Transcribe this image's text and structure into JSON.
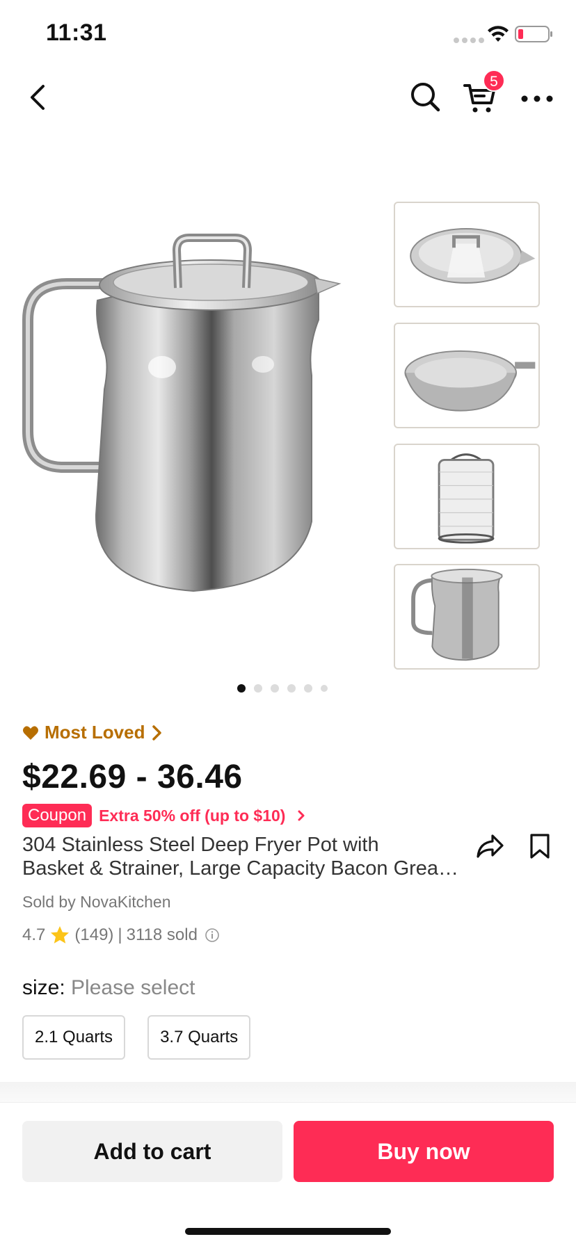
{
  "status_bar": {
    "time": "11:31"
  },
  "nav": {
    "cart_count": "5",
    "icons": [
      "back-icon",
      "search-icon",
      "cart-icon",
      "more-icon"
    ]
  },
  "gallery": {
    "thumbnails": [
      "lid",
      "strainer",
      "basket",
      "pot"
    ],
    "page_count": 6,
    "active_page": 1
  },
  "product": {
    "badge": "Most Loved",
    "price": "$22.69 - 36.46",
    "coupon": {
      "label": "Coupon",
      "text": "Extra 50% off (up to $10)"
    },
    "title_line1": "304 Stainless Steel Deep Fryer Pot with",
    "title_line2": "Basket & Strainer, Large Capacity Bacon Grease Container",
    "seller": "Sold by NovaKitchen",
    "rating": "4.7",
    "reviews": "(149)",
    "separator": "|",
    "sold": "3118 sold"
  },
  "size": {
    "label": "size:",
    "value": "Please select",
    "options": [
      "2.1 Quarts",
      "3.7 Quarts"
    ]
  },
  "actions": {
    "add_to_cart": "Add to cart",
    "buy_now": "Buy now"
  },
  "colors": {
    "accent": "#fe2c55",
    "badge": "#b76e00"
  }
}
